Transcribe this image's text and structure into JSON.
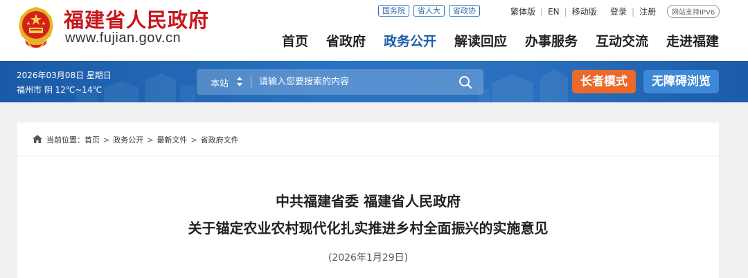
{
  "header": {
    "site_name": "福建省人民政府",
    "site_url": "www.fujian.gov.cn",
    "top_links": [
      "国务院",
      "省人大",
      "省政协"
    ],
    "lang_links": [
      "繁体版",
      "EN",
      "移动版"
    ],
    "account_links": [
      "登录",
      "注册"
    ],
    "ipv6_badge": "网站支持IPV6"
  },
  "nav": {
    "items": [
      "首页",
      "省政府",
      "政务公开",
      "解读回应",
      "办事服务",
      "互动交流",
      "走进福建"
    ],
    "active": "政务公开"
  },
  "banner": {
    "date": "2026年03月08日 星期日",
    "weather": "福州市 阴 12℃~14℃",
    "search_scope": "本站",
    "search_placeholder": "请输入您要搜索的内容",
    "elder_mode": "长者模式",
    "accessible_mode": "无障碍浏览"
  },
  "breadcrumb": {
    "prefix": "当前位置：",
    "items": [
      "首页",
      "政务公开",
      "最新文件",
      "省政府文件"
    ]
  },
  "article": {
    "title_line1": "中共福建省委 福建省人民政府",
    "title_line2": "关于锚定农业农村现代化扎实推进乡村全面振兴的实施意见",
    "date": "(2026年1月29日)"
  },
  "colors": {
    "brand_red": "#c8161d",
    "nav_active": "#1d5fa8",
    "banner_blue": "#2a70bf",
    "elder_orange": "#ea6a2c",
    "access_blue": "#3e88d8"
  },
  "icons": [
    "national-emblem-icon",
    "sort-arrows-icon",
    "search-icon",
    "home-icon"
  ]
}
